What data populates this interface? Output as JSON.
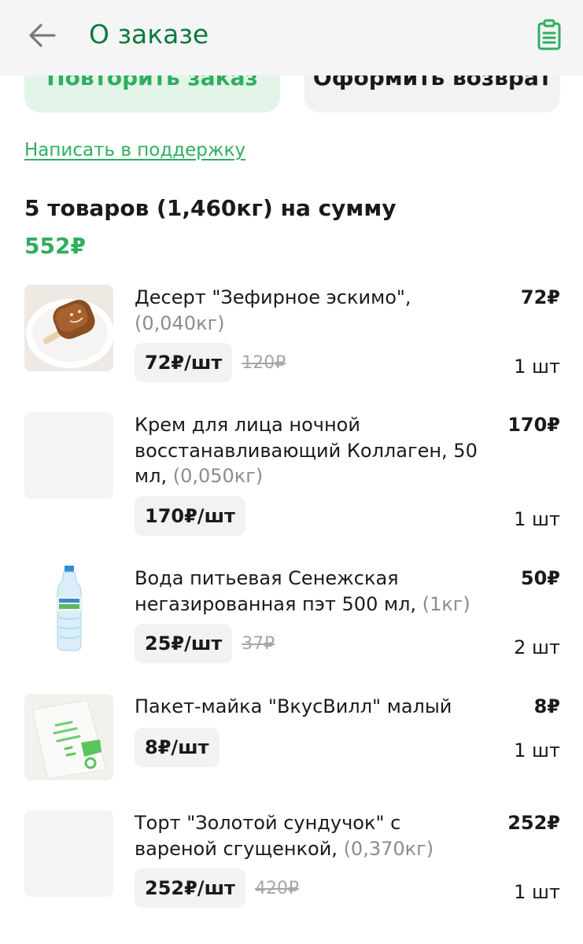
{
  "header": {
    "title": "О заказе",
    "back_icon": "arrow-left-icon",
    "receipt_icon": "receipt-icon"
  },
  "actions": {
    "repeat_label": "Повторить заказ",
    "return_label": "Оформить возврат"
  },
  "support_link": "Написать в поддержку",
  "summary": {
    "text": "5 товаров (1,460кг) на сумму",
    "total": "552₽"
  },
  "items": [
    {
      "name": "Десерт \"Зефирное эскимо\", ",
      "weight": "(0,040кг)",
      "total": "72₽",
      "unit_price": "72₽/шт",
      "old_price": "120₽",
      "qty": "1 шт",
      "image": "ice-cream-bar"
    },
    {
      "name": "Крем для лица ночной восстанавливающий Коллаген, 50 мл, ",
      "weight": "(0,050кг)",
      "total": "170₽",
      "unit_price": "170₽/шт",
      "old_price": "",
      "qty": "1 шт",
      "image": "placeholder"
    },
    {
      "name": "Вода питьевая Сенежская негазированная пэт 500 мл, ",
      "weight": "(1кг)",
      "total": "50₽",
      "unit_price": "25₽/шт",
      "old_price": "37₽",
      "qty": "2 шт",
      "image": "water-bottle"
    },
    {
      "name": "Пакет-майка \"ВкусВилл\" малый",
      "weight": "",
      "total": "8₽",
      "unit_price": "8₽/шт",
      "old_price": "",
      "qty": "1 шт",
      "image": "plastic-bag"
    },
    {
      "name": "Торт \"Золотой сундучок\" с вареной сгущенкой, ",
      "weight": "(0,370кг)",
      "total": "252₽",
      "unit_price": "252₽/шт",
      "old_price": "420₽",
      "qty": "1 шт",
      "image": "placeholder"
    }
  ],
  "colors": {
    "brand_green": "#2fae5f",
    "title_green": "#0a7a3c",
    "muted": "#8c8c8c"
  }
}
